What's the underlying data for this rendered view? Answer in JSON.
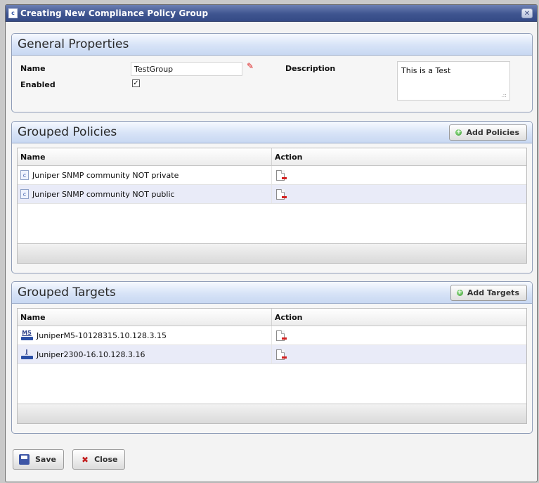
{
  "window": {
    "title": "Creating New Compliance Policy Group",
    "title_icon": "c"
  },
  "general": {
    "title": "General Properties",
    "name_label": "Name",
    "name_value": "TestGroup",
    "enabled_label": "Enabled",
    "enabled_mark": "✓",
    "description_label": "Description",
    "description_value": "This is a Test"
  },
  "policies": {
    "title": "Grouped Policies",
    "add_label": "Add Policies",
    "headers": {
      "name": "Name",
      "action": "Action"
    },
    "rows": [
      {
        "name": "Juniper SNMP community NOT private",
        "icon": "c"
      },
      {
        "name": "Juniper SNMP community NOT public",
        "icon": "c"
      }
    ]
  },
  "targets": {
    "title": "Grouped Targets",
    "add_label": "Add Targets",
    "headers": {
      "name": "Name",
      "action": "Action"
    },
    "rows": [
      {
        "name": "JuniperM5-10128315.10.128.3.15",
        "tag": "M5"
      },
      {
        "name": "Juniper2300-16.10.128.3.16",
        "tag": "J"
      }
    ]
  },
  "footer": {
    "save_label": "Save",
    "close_label": "Close"
  }
}
